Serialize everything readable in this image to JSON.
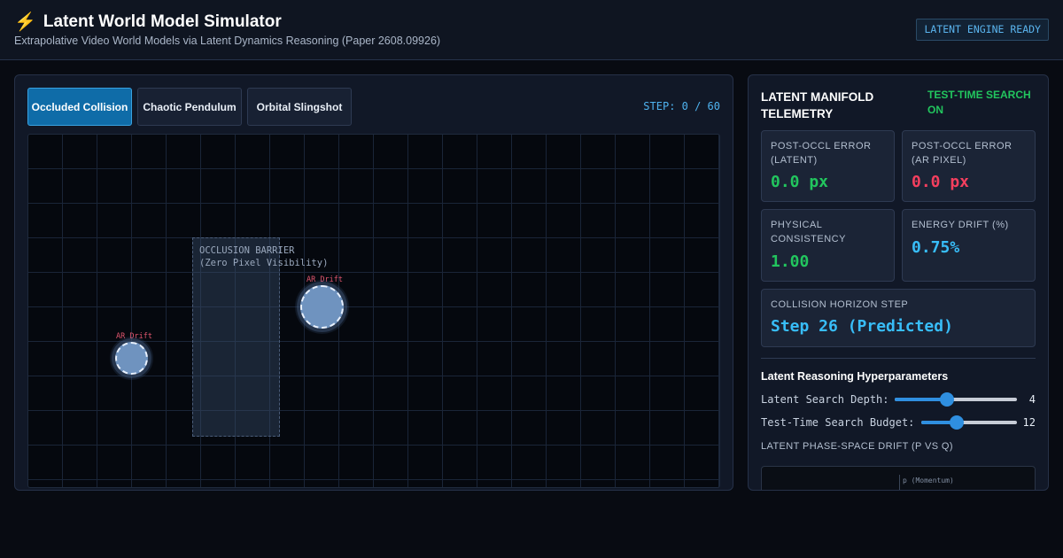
{
  "header": {
    "icon": "lightning-bolt-icon",
    "title": "Latent World Model Simulator",
    "subtitle": "Extrapolative Video World Models via Latent Dynamics Reasoning (Paper 2608.09926)",
    "engine_status": "LATENT ENGINE READY"
  },
  "simulation": {
    "tabs": [
      {
        "label": "Occluded Collision",
        "active": true
      },
      {
        "label": "Chaotic Pendulum",
        "active": false
      },
      {
        "label": "Orbital Slingshot",
        "active": false
      }
    ],
    "step_counter": "STEP: 0 / 60",
    "barrier_label_line1": "OCCLUSION BARRIER",
    "barrier_label_line2": "(Zero Pixel Visibility)",
    "ball_left_label": "AR Drift",
    "ball_right_label": "AR Drift"
  },
  "telemetry": {
    "title": "LATENT MANIFOLD TELEMETRY",
    "search_status": "TEST-TIME SEARCH ON",
    "cards": {
      "latent_error": {
        "label": "POST-OCCL ERROR (LATENT)",
        "value": "0.0 px"
      },
      "pixel_error": {
        "label": "POST-OCCL ERROR (AR PIXEL)",
        "value": "0.0 px"
      },
      "consistency": {
        "label": "PHYSICAL CONSISTENCY",
        "value": "1.00"
      },
      "energy_drift": {
        "label": "ENERGY DRIFT (%)",
        "value": "0.75%"
      },
      "horizon": {
        "label": "COLLISION HORIZON STEP",
        "value": "Step 26 (Predicted)"
      }
    },
    "colors": {
      "good": "#22c55e",
      "bad": "#f43f5e",
      "info": "#38bdf8"
    }
  },
  "hyperparameters": {
    "title": "Latent Reasoning Hyperparameters",
    "search_depth": {
      "label": "Latent Search Depth:",
      "value": 4,
      "fraction": 0.43
    },
    "search_budget": {
      "label": "Test-Time Search Budget:",
      "value": 12,
      "fraction": 0.37
    },
    "phase_space_title": "LATENT PHASE-SPACE DRIFT (P VS Q)",
    "phase_axis_label": "p (Momentum)"
  }
}
